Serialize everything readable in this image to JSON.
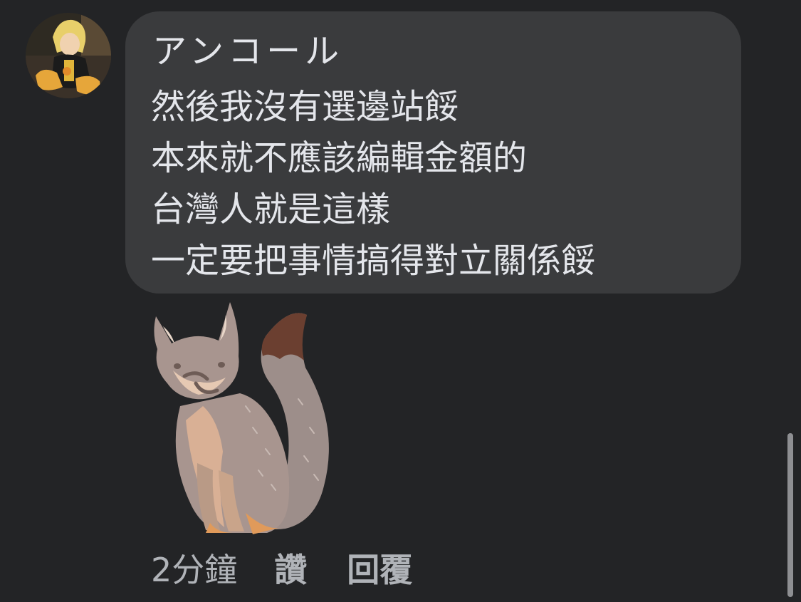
{
  "comment": {
    "author": "アンコール",
    "lines": [
      "然後我沒有選邊站餒",
      "本來就不應該編輯金額的",
      "台灣人就是這樣",
      "一定要把事情搞得對立關係餒"
    ],
    "sticker_icon": "fox-sticker",
    "avatar_icon": "user-avatar"
  },
  "actions": {
    "time": "2分鐘",
    "like": "讚",
    "reply": "回覆"
  },
  "colors": {
    "background": "#232426",
    "bubble": "#3a3b3d",
    "text": "#e4e6eb",
    "meta_text": "#b0b3b8"
  }
}
